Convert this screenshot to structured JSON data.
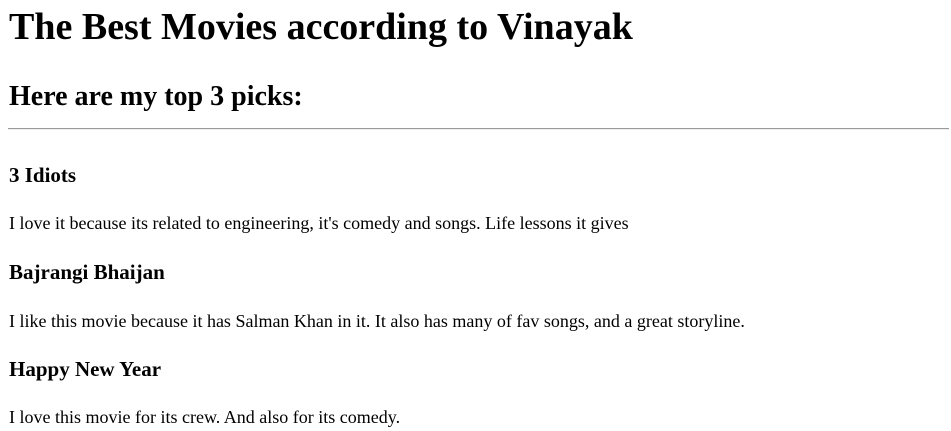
{
  "page": {
    "title": "The Best Movies according to Vinayak",
    "subtitle": "Here are my top 3 picks:"
  },
  "movies": [
    {
      "title": "3 Idiots",
      "description": "I love it because its related to engineering, it's comedy and songs. Life lessons it gives"
    },
    {
      "title": "Bajrangi Bhaijan",
      "description": "I like this movie because it has Salman Khan in it. It also has many of fav songs, and a great storyline."
    },
    {
      "title": "Happy New Year",
      "description": "I love this movie for its crew. And also for its comedy."
    }
  ]
}
